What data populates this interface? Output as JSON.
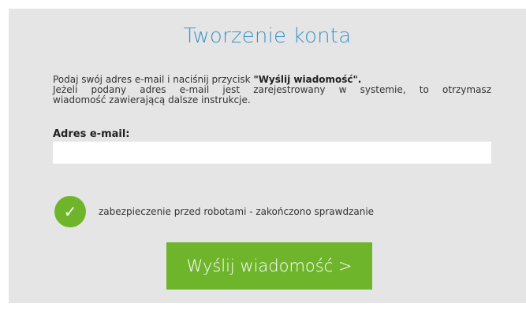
{
  "page": {
    "title": "Tworzenie konta"
  },
  "instructions": {
    "line1_prefix": "Podaj swój adres e-mail i naciśnij przycisk ",
    "line1_bold": "\"Wyślij wiadomość\".",
    "line2": "Jeżeli podany adres e-mail jest zarejestrowany w systemie, to otrzymasz",
    "line3": "wiadomość zawierającą dalsze instrukcje."
  },
  "email": {
    "label": "Adres e-mail:",
    "value": "",
    "placeholder": ""
  },
  "captcha": {
    "icon": "checkmark-icon",
    "text": "zabezpieczenie przed robotami - zakończono sprawdzanie",
    "status_color": "#6fb52c"
  },
  "submit": {
    "label": "Wyślij wiadomość >"
  },
  "colors": {
    "accent_title": "#3d94c9",
    "button_green": "#6fb52c",
    "panel_bg": "#e5e5e5"
  }
}
